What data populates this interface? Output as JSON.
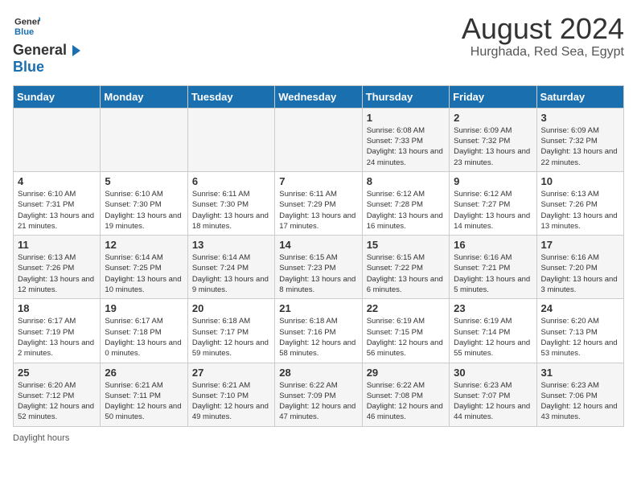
{
  "header": {
    "logo": {
      "text_general": "General",
      "text_blue": "Blue"
    },
    "title": "August 2024",
    "location": "Hurghada, Red Sea, Egypt"
  },
  "days_of_week": [
    "Sunday",
    "Monday",
    "Tuesday",
    "Wednesday",
    "Thursday",
    "Friday",
    "Saturday"
  ],
  "weeks": [
    [
      {
        "day": "",
        "info": ""
      },
      {
        "day": "",
        "info": ""
      },
      {
        "day": "",
        "info": ""
      },
      {
        "day": "",
        "info": ""
      },
      {
        "day": "1",
        "info": "Sunrise: 6:08 AM\nSunset: 7:33 PM\nDaylight: 13 hours and 24 minutes."
      },
      {
        "day": "2",
        "info": "Sunrise: 6:09 AM\nSunset: 7:32 PM\nDaylight: 13 hours and 23 minutes."
      },
      {
        "day": "3",
        "info": "Sunrise: 6:09 AM\nSunset: 7:32 PM\nDaylight: 13 hours and 22 minutes."
      }
    ],
    [
      {
        "day": "4",
        "info": "Sunrise: 6:10 AM\nSunset: 7:31 PM\nDaylight: 13 hours and 21 minutes."
      },
      {
        "day": "5",
        "info": "Sunrise: 6:10 AM\nSunset: 7:30 PM\nDaylight: 13 hours and 19 minutes."
      },
      {
        "day": "6",
        "info": "Sunrise: 6:11 AM\nSunset: 7:30 PM\nDaylight: 13 hours and 18 minutes."
      },
      {
        "day": "7",
        "info": "Sunrise: 6:11 AM\nSunset: 7:29 PM\nDaylight: 13 hours and 17 minutes."
      },
      {
        "day": "8",
        "info": "Sunrise: 6:12 AM\nSunset: 7:28 PM\nDaylight: 13 hours and 16 minutes."
      },
      {
        "day": "9",
        "info": "Sunrise: 6:12 AM\nSunset: 7:27 PM\nDaylight: 13 hours and 14 minutes."
      },
      {
        "day": "10",
        "info": "Sunrise: 6:13 AM\nSunset: 7:26 PM\nDaylight: 13 hours and 13 minutes."
      }
    ],
    [
      {
        "day": "11",
        "info": "Sunrise: 6:13 AM\nSunset: 7:26 PM\nDaylight: 13 hours and 12 minutes."
      },
      {
        "day": "12",
        "info": "Sunrise: 6:14 AM\nSunset: 7:25 PM\nDaylight: 13 hours and 10 minutes."
      },
      {
        "day": "13",
        "info": "Sunrise: 6:14 AM\nSunset: 7:24 PM\nDaylight: 13 hours and 9 minutes."
      },
      {
        "day": "14",
        "info": "Sunrise: 6:15 AM\nSunset: 7:23 PM\nDaylight: 13 hours and 8 minutes."
      },
      {
        "day": "15",
        "info": "Sunrise: 6:15 AM\nSunset: 7:22 PM\nDaylight: 13 hours and 6 minutes."
      },
      {
        "day": "16",
        "info": "Sunrise: 6:16 AM\nSunset: 7:21 PM\nDaylight: 13 hours and 5 minutes."
      },
      {
        "day": "17",
        "info": "Sunrise: 6:16 AM\nSunset: 7:20 PM\nDaylight: 13 hours and 3 minutes."
      }
    ],
    [
      {
        "day": "18",
        "info": "Sunrise: 6:17 AM\nSunset: 7:19 PM\nDaylight: 13 hours and 2 minutes."
      },
      {
        "day": "19",
        "info": "Sunrise: 6:17 AM\nSunset: 7:18 PM\nDaylight: 13 hours and 0 minutes."
      },
      {
        "day": "20",
        "info": "Sunrise: 6:18 AM\nSunset: 7:17 PM\nDaylight: 12 hours and 59 minutes."
      },
      {
        "day": "21",
        "info": "Sunrise: 6:18 AM\nSunset: 7:16 PM\nDaylight: 12 hours and 58 minutes."
      },
      {
        "day": "22",
        "info": "Sunrise: 6:19 AM\nSunset: 7:15 PM\nDaylight: 12 hours and 56 minutes."
      },
      {
        "day": "23",
        "info": "Sunrise: 6:19 AM\nSunset: 7:14 PM\nDaylight: 12 hours and 55 minutes."
      },
      {
        "day": "24",
        "info": "Sunrise: 6:20 AM\nSunset: 7:13 PM\nDaylight: 12 hours and 53 minutes."
      }
    ],
    [
      {
        "day": "25",
        "info": "Sunrise: 6:20 AM\nSunset: 7:12 PM\nDaylight: 12 hours and 52 minutes."
      },
      {
        "day": "26",
        "info": "Sunrise: 6:21 AM\nSunset: 7:11 PM\nDaylight: 12 hours and 50 minutes."
      },
      {
        "day": "27",
        "info": "Sunrise: 6:21 AM\nSunset: 7:10 PM\nDaylight: 12 hours and 49 minutes."
      },
      {
        "day": "28",
        "info": "Sunrise: 6:22 AM\nSunset: 7:09 PM\nDaylight: 12 hours and 47 minutes."
      },
      {
        "day": "29",
        "info": "Sunrise: 6:22 AM\nSunset: 7:08 PM\nDaylight: 12 hours and 46 minutes."
      },
      {
        "day": "30",
        "info": "Sunrise: 6:23 AM\nSunset: 7:07 PM\nDaylight: 12 hours and 44 minutes."
      },
      {
        "day": "31",
        "info": "Sunrise: 6:23 AM\nSunset: 7:06 PM\nDaylight: 12 hours and 43 minutes."
      }
    ]
  ],
  "footer": {
    "daylight_label": "Daylight hours"
  }
}
